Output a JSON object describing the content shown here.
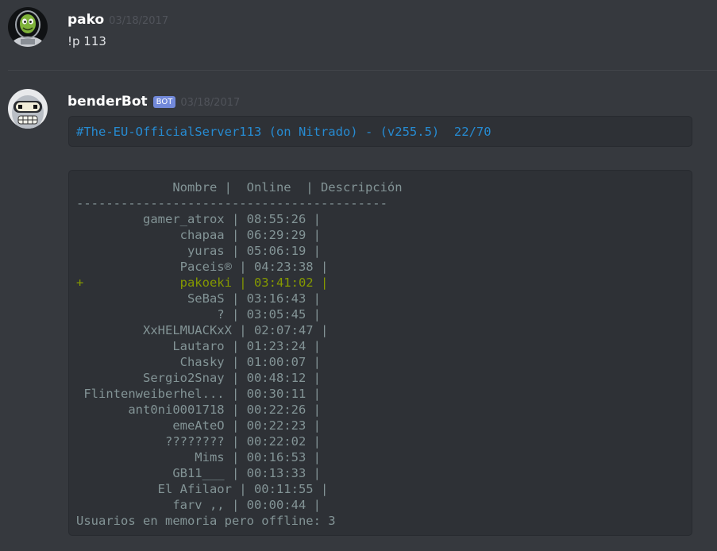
{
  "messages": [
    {
      "username": "pako",
      "timestamp": "03/18/2017",
      "text": "!p 113"
    },
    {
      "username": "benderBot",
      "bot_tag": "BOT",
      "timestamp": "03/18/2017",
      "server_line": "#The-EU-OfficialServer113 (on Nitrado) - (v255.5)  22/70",
      "table": {
        "header": "             Nombre |  Online  | Descripción",
        "separator": "------------------------------------------",
        "rows": [
          {
            "line": "         gamer_atrox | 08:55:26 |",
            "highlight": false
          },
          {
            "line": "              chapaa | 06:29:29 |",
            "highlight": false
          },
          {
            "line": "               yuras | 05:06:19 |",
            "highlight": false
          },
          {
            "line": "              Paceis® | 04:23:38 |",
            "highlight": false
          },
          {
            "line": "+             pakoeki | 03:41:02 |",
            "highlight": true
          },
          {
            "line": "               SeBaS | 03:16:43 |",
            "highlight": false
          },
          {
            "line": "                   ? | 03:05:45 |",
            "highlight": false
          },
          {
            "line": "         XxHELMUACKxX | 02:07:47 |",
            "highlight": false
          },
          {
            "line": "             Lautaro | 01:23:24 |",
            "highlight": false
          },
          {
            "line": "              Chasky | 01:00:07 |",
            "highlight": false
          },
          {
            "line": "         Sergio2Snay | 00:48:12 |",
            "highlight": false
          },
          {
            "line": " Flintenweiberhel... | 00:30:11 |",
            "highlight": false
          },
          {
            "line": "       ant0ni0001718 | 00:22:26 |",
            "highlight": false
          },
          {
            "line": "             emeAteO | 00:22:23 |",
            "highlight": false
          },
          {
            "line": "            ???????? | 00:22:02 |",
            "highlight": false
          },
          {
            "line": "                Mims | 00:16:53 |",
            "highlight": false
          },
          {
            "line": "             GB11___ | 00:13:33 |",
            "highlight": false
          },
          {
            "line": "           El Afilaor | 00:11:55 |",
            "highlight": false
          },
          {
            "line": "             farv ,, | 00:00:44 |",
            "highlight": false
          }
        ],
        "footer": "Usuarios en memoria pero offline: 3"
      }
    }
  ],
  "colors": {
    "background": "#36393e",
    "code_background": "#2e3136",
    "code_text": "#839496",
    "server_line": "#268bd2",
    "highlight_row": "#859900",
    "bot_tag": "#7289da"
  }
}
